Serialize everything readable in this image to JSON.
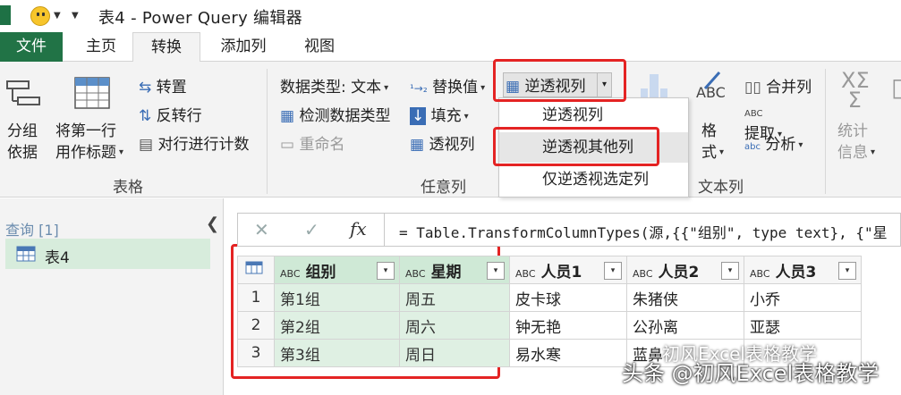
{
  "window": {
    "title": "表4 - Power Query 编辑器"
  },
  "menu": {
    "file": "文件",
    "home": "主页",
    "transform": "转换",
    "add_column": "添加列",
    "view": "视图"
  },
  "ribbon": {
    "table_group": {
      "label": "表格",
      "group_by": [
        "分组",
        "依据"
      ],
      "use_first_row": [
        "将第一行",
        "用作标题"
      ],
      "transpose": "转置",
      "reverse_rows": "反转行",
      "count_rows": "对行进行计数"
    },
    "any_column_group": {
      "label": "任意列",
      "data_type": "数据类型: 文本",
      "detect_type": "检测数据类型",
      "rename": "重命名",
      "replace_values": "替换值",
      "fill": "填充",
      "pivot": "透视列",
      "unpivot": "逆透视列"
    },
    "text_column_group": {
      "label": "文本列",
      "format": [
        "格",
        "式"
      ],
      "merge_columns": "合并列",
      "extract": "提取",
      "parse": "分析"
    },
    "number_column_group": {
      "statistics": [
        "统计",
        "信息"
      ]
    }
  },
  "unpivot_menu": {
    "items": [
      "逆透视列",
      "逆透视其他列",
      "仅逆透视选定列"
    ]
  },
  "queries": {
    "header": "查询 [1]",
    "items": [
      "表4"
    ]
  },
  "formula": {
    "text": "= Table.TransformColumnTypes(源,{{\"组别\", type text}, {\"星"
  },
  "table": {
    "type_icon": "ABC",
    "columns": [
      "组别",
      "星期",
      "人员1",
      "人员2",
      "人员3"
    ],
    "rows": [
      {
        "n": "1",
        "cells": [
          "第1组",
          "周五",
          "皮卡球",
          "朱猪侠",
          "小乔"
        ]
      },
      {
        "n": "2",
        "cells": [
          "第2组",
          "周六",
          "钟无艳",
          "公孙离",
          "亚瑟"
        ]
      },
      {
        "n": "3",
        "cells": [
          "第3组",
          "周日",
          "易水寒",
          "蓝鼻",
          ""
        ]
      }
    ]
  },
  "watermark": {
    "line1": "初风Excel表格教学",
    "line2": "头条 @初风Excel表格教学"
  },
  "colors": {
    "excel_green": "#217346",
    "highlight": "#e42323",
    "selected_column": "#dff0e3"
  }
}
